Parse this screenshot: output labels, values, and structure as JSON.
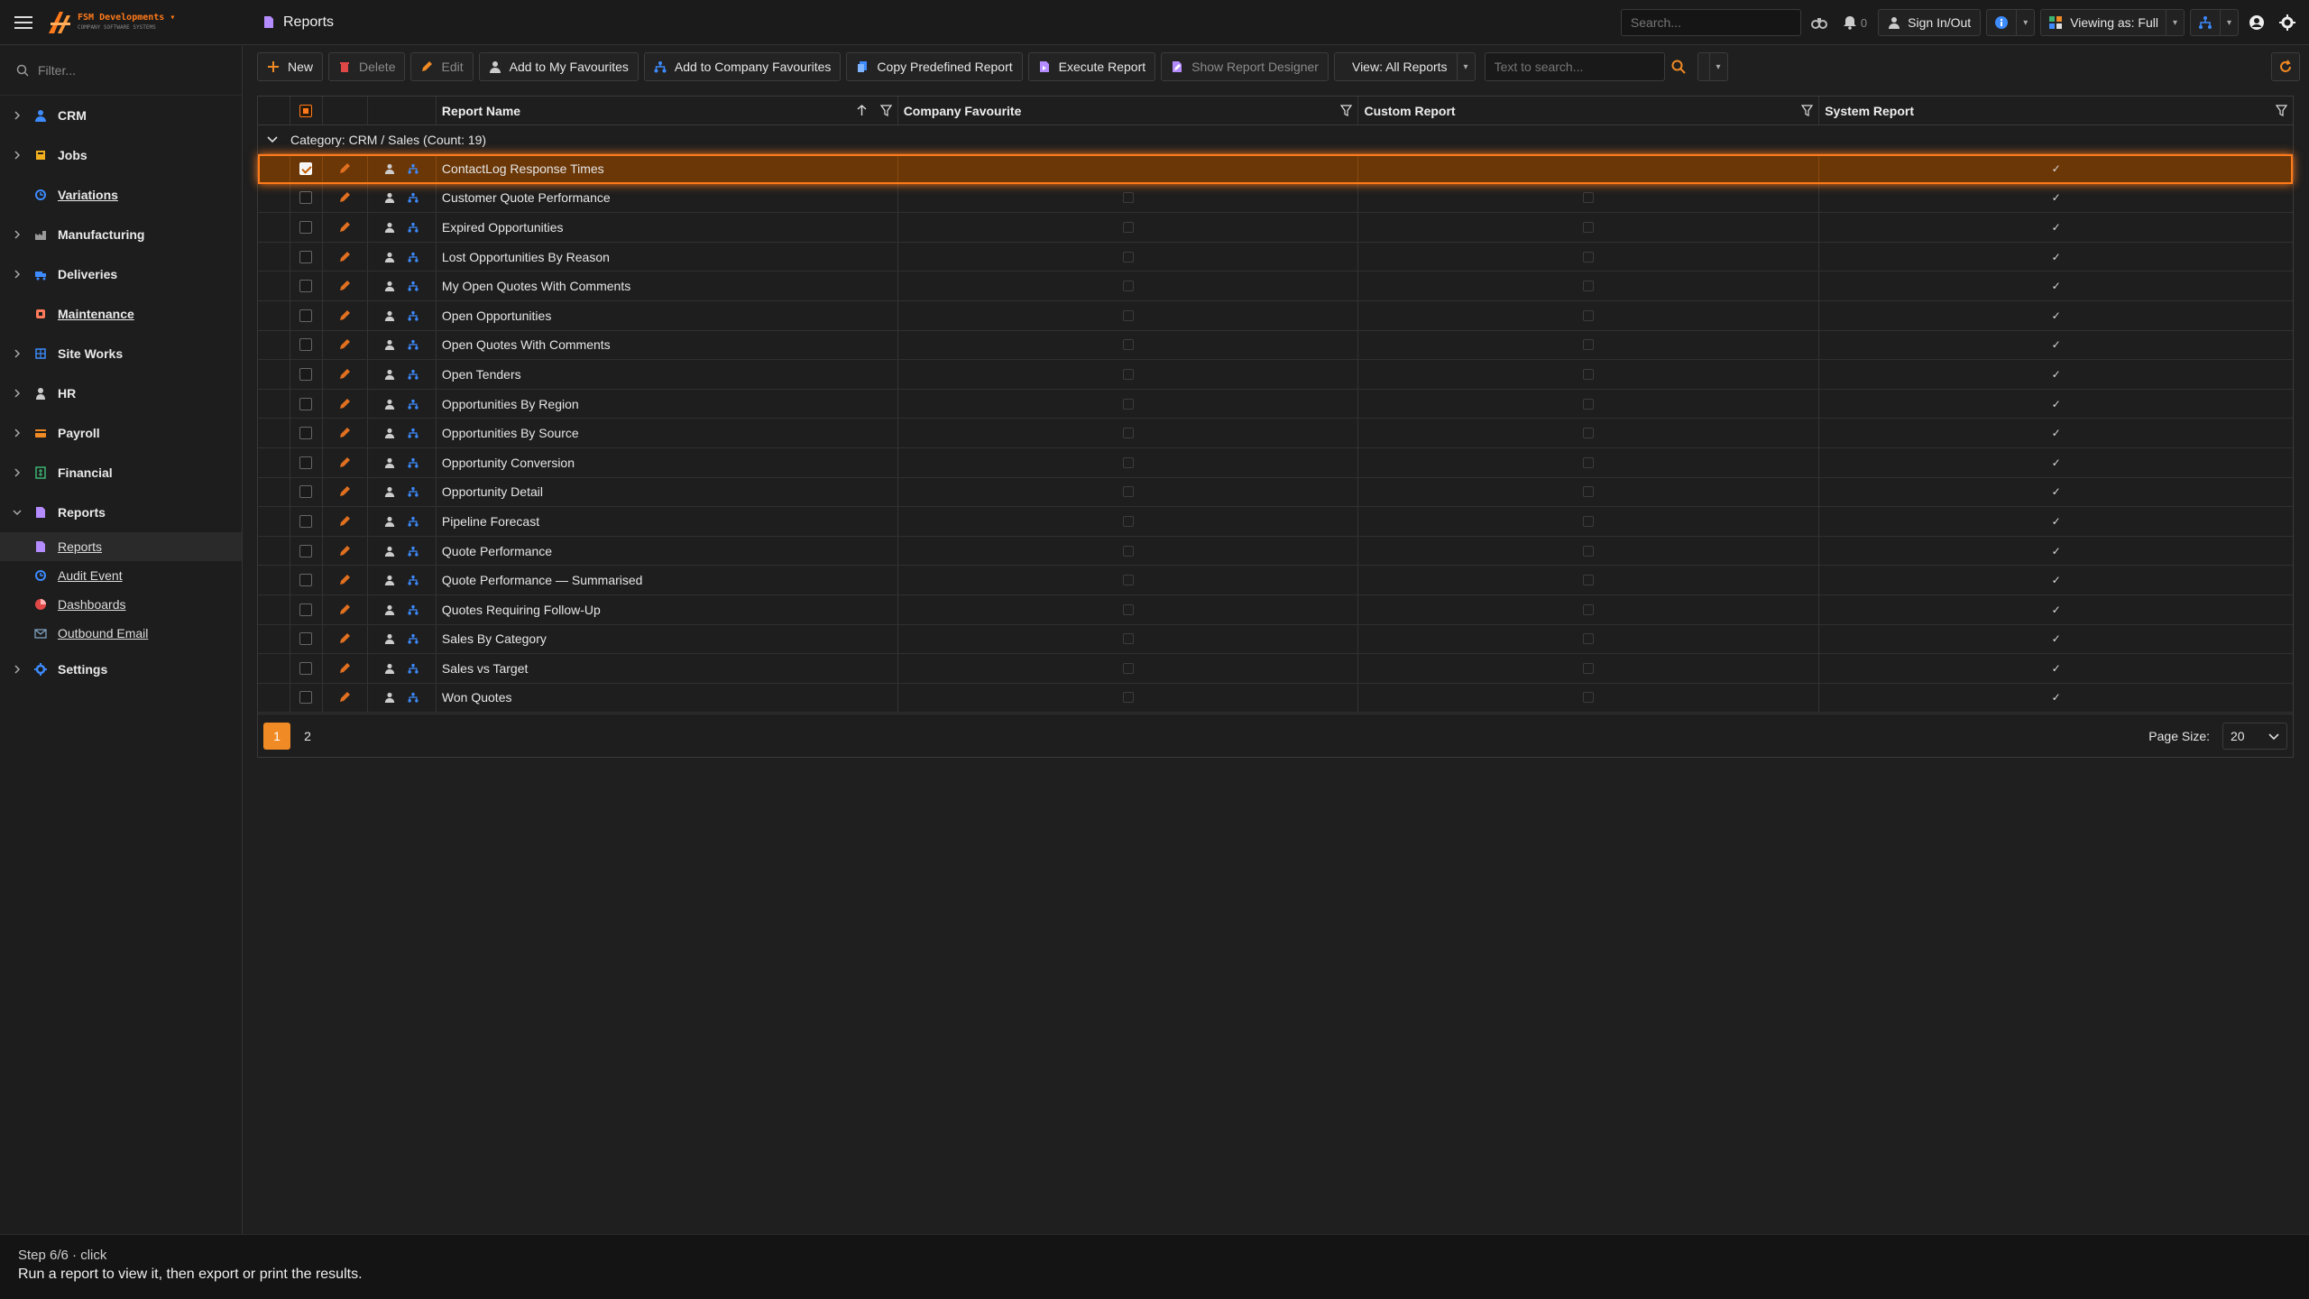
{
  "header": {
    "brand": "FSM Developments",
    "brand_tagline": "COMPANY SOFTWARE SYSTEMS",
    "page_title": "Reports",
    "search_placeholder": "Search...",
    "notification_count": "0",
    "sign_in_out": "Sign In/Out",
    "viewing_as": "Viewing as: Full"
  },
  "sidebar": {
    "filter_placeholder": "Filter...",
    "items": [
      {
        "label": "CRM",
        "icon": "person-icon",
        "color": "#3d8bfd",
        "expandable": true
      },
      {
        "label": "Jobs",
        "icon": "jobs-icon",
        "color": "#f2b01e",
        "expandable": true
      },
      {
        "label": "Variations",
        "icon": "variations-icon",
        "color": "#3d8bfd",
        "expandable": false,
        "link": true
      },
      {
        "label": "Manufacturing",
        "icon": "factory-icon",
        "color": "#999999",
        "expandable": true
      },
      {
        "label": "Deliveries",
        "icon": "truck-icon",
        "color": "#3d8bfd",
        "expandable": true
      },
      {
        "label": "Maintenance",
        "icon": "maintenance-icon",
        "color": "#ff7a5a",
        "expandable": false,
        "link": true
      },
      {
        "label": "Site Works",
        "icon": "siteworks-icon",
        "color": "#3d8bfd",
        "expandable": true
      },
      {
        "label": "HR",
        "icon": "hr-icon",
        "color": "#cccccc",
        "expandable": true
      },
      {
        "label": "Payroll",
        "icon": "payroll-icon",
        "color": "#f08a24",
        "expandable": true
      },
      {
        "label": "Financial",
        "icon": "financial-icon",
        "color": "#3cb371",
        "expandable": true
      },
      {
        "label": "Reports",
        "icon": "reports-icon",
        "color": "#b58cff",
        "expandable": true,
        "expanded": true
      }
    ],
    "reports_children": [
      {
        "label": "Reports",
        "icon": "reports-icon",
        "active": true
      },
      {
        "label": "Audit Event",
        "icon": "audit-icon"
      },
      {
        "label": "Dashboards",
        "icon": "dashboard-icon"
      },
      {
        "label": "Outbound Email",
        "icon": "email-icon"
      }
    ],
    "settings_label": "Settings"
  },
  "toolbar": {
    "new": "New",
    "delete": "Delete",
    "edit": "Edit",
    "add_my_fav": "Add to My Favourites",
    "add_company_fav": "Add to Company Favourites",
    "copy_predefined": "Copy Predefined Report",
    "execute": "Execute Report",
    "show_designer": "Show Report Designer",
    "view_all": "View: All Reports",
    "search_placeholder": "Text to search..."
  },
  "grid": {
    "columns": {
      "report_name": "Report Name",
      "company_favourite": "Company Favourite",
      "custom_report": "Custom Report",
      "system_report": "System Report"
    },
    "group_label": "Category: CRM / Sales (Count: 19)",
    "rows": [
      "ContactLog Response Times",
      "Customer Quote Performance",
      "Expired Opportunities",
      "Lost Opportunities By Reason",
      "My Open Quotes With Comments",
      "Open Opportunities",
      "Open Quotes With Comments",
      "Open Tenders",
      "Opportunities By Region",
      "Opportunities By Source",
      "Opportunity Conversion",
      "Opportunity Detail",
      "Pipeline Forecast",
      "Quote Performance",
      "Quote Performance — Summarised",
      "Quotes Requiring Follow-Up",
      "Sales By Category",
      "Sales vs Target",
      "Won Quotes"
    ],
    "selected_index": 0,
    "pages": [
      "1",
      "2"
    ],
    "current_page": "1",
    "page_size_label": "Page Size:",
    "page_size": "20"
  },
  "tutorial": {
    "step": "Step 6/6 · click",
    "message": "Run a report to view it, then export or print the results."
  },
  "colors": {
    "accent": "#ff7a1a",
    "selected_row": "#6b3707",
    "link_blue": "#3d8bfd"
  }
}
